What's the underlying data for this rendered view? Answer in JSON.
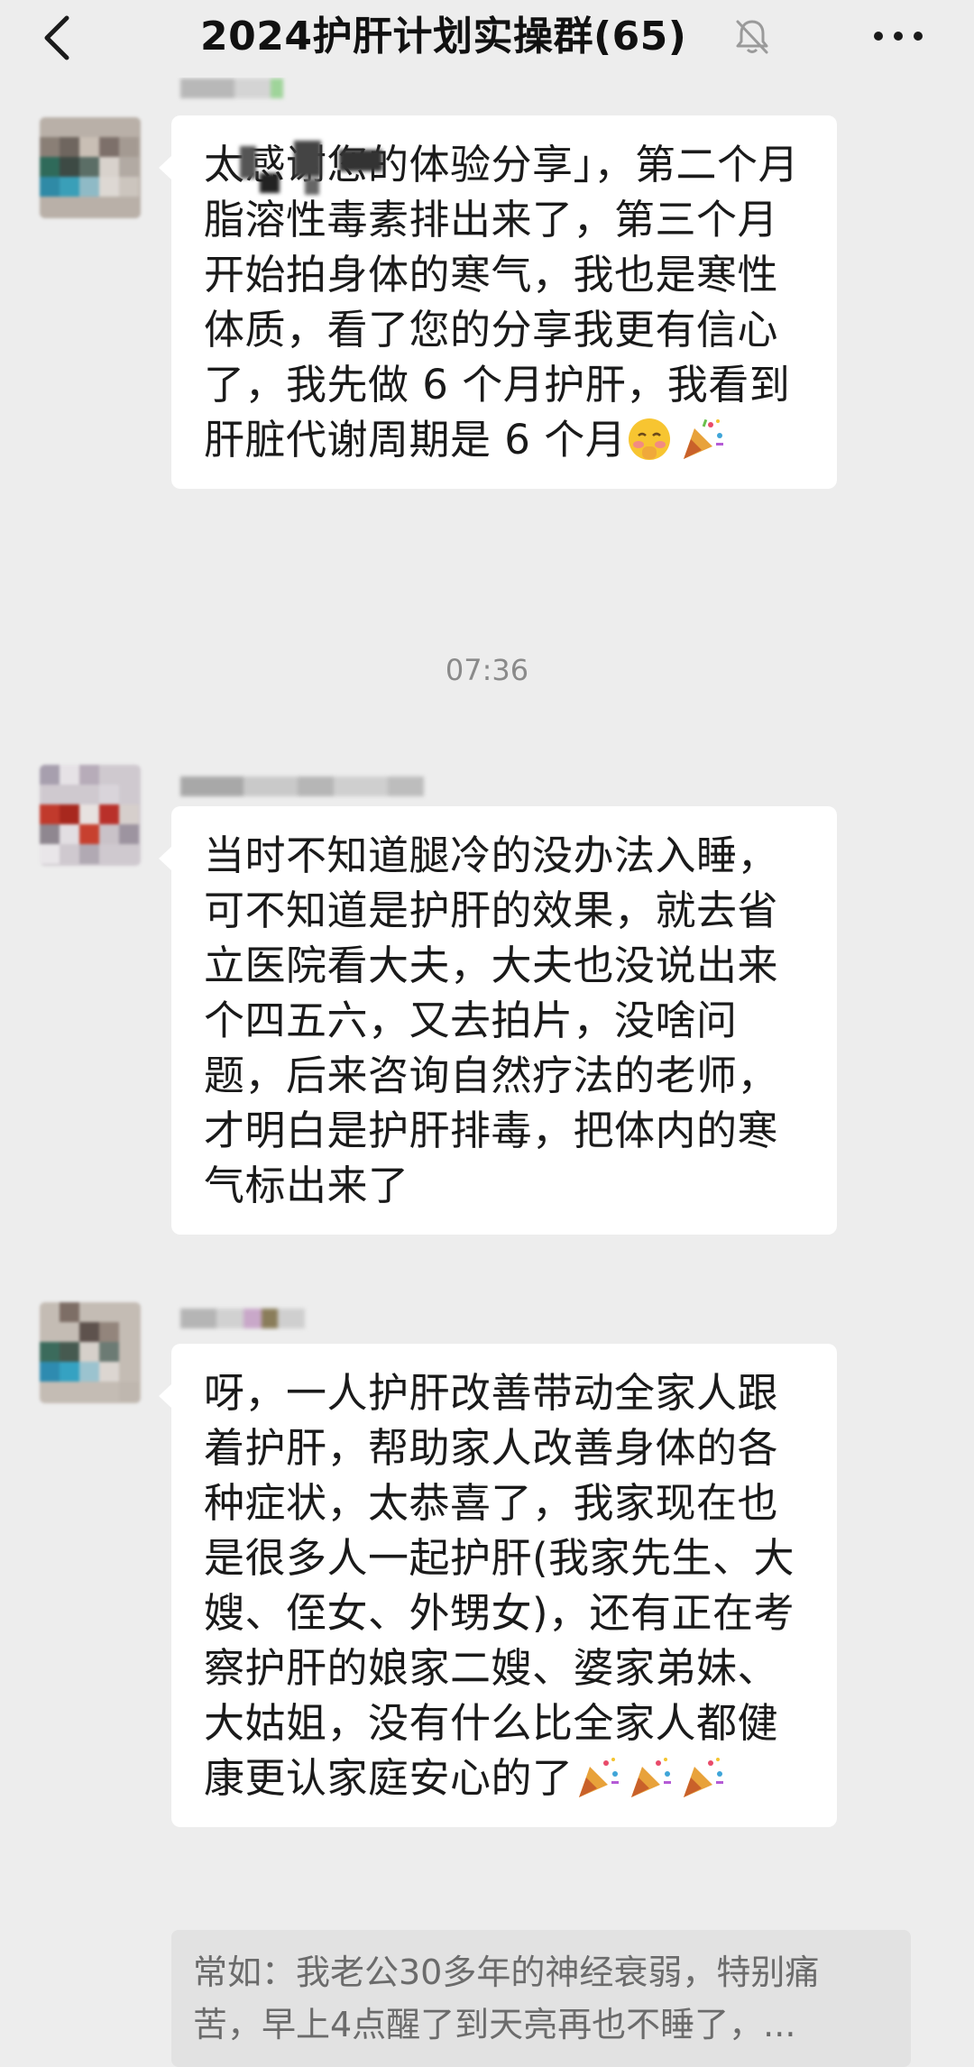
{
  "header": {
    "title": "2024护肝计划实操群(65)",
    "back_icon": "chevron-left-icon",
    "mute_icon": "bell-muted-icon",
    "more_icon": "more-dots-icon"
  },
  "messages": [
    {
      "text": "太感谢您的体验分享」，第二个月脂溶性毒素排出来了，第三个月开始拍身体的寒气，我也是寒性体质，看了您的分享我更有信心了，我先做 6 个月护肝，我看到肝脏代谢周期是 6 个月",
      "emojis": [
        "shy-face-emoji",
        "party-popper-emoji"
      ]
    },
    {
      "text": "当时不知道腿冷的没办法入睡，可不知道是护肝的效果，就去省立医院看大夫，大夫也没说出来个四五六，又去拍片，没啥问题，后来咨询自然疗法的老师，才明白是护肝排毒，把体内的寒气标出来了",
      "emojis": []
    },
    {
      "text": "呀，一人护肝改善带动全家人跟着护肝，帮助家人改善身体的各种症状，太恭喜了，我家现在也是很多人一起护肝(我家先生、大嫂、侄女、外甥女)，还有正在考察护肝的娘家二嫂、婆家弟妹、大姑姐，没有什么比全家人都健康更认家庭安心的了",
      "emojis": [
        "party-popper-emoji",
        "party-popper-emoji",
        "party-popper-emoji"
      ]
    }
  ],
  "time_divider": "07:36",
  "quote": {
    "text": "常如：我老公30多年的神经衰弱，特别痛苦，早上4点醒了到天亮再也不睡了，..."
  },
  "colors": {
    "background": "#ededed",
    "bubble": "#ffffff",
    "quote_bg": "#e2e2e2",
    "time_text": "#8a8a8a"
  }
}
